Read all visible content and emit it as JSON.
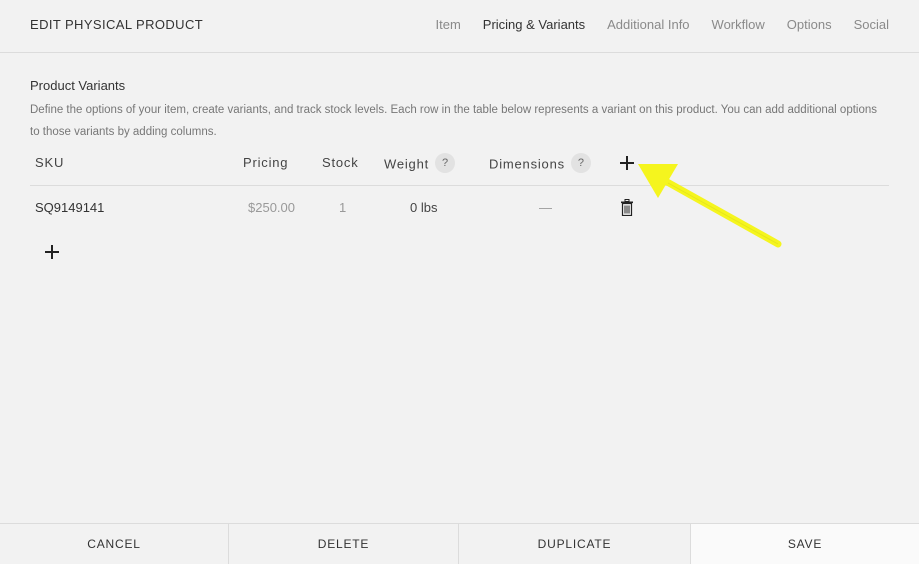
{
  "header": {
    "title": "EDIT PHYSICAL PRODUCT",
    "tabs": [
      {
        "label": "Item",
        "active": false
      },
      {
        "label": "Pricing & Variants",
        "active": true
      },
      {
        "label": "Additional Info",
        "active": false
      },
      {
        "label": "Workflow",
        "active": false
      },
      {
        "label": "Options",
        "active": false
      },
      {
        "label": "Social",
        "active": false
      }
    ]
  },
  "section": {
    "title": "Product Variants",
    "description": "Define the options of your item, create variants, and track stock levels. Each row in the table below represents a variant on this product. You can add additional options to those variants by adding columns."
  },
  "table": {
    "columns": {
      "sku": "SKU",
      "pricing": "Pricing",
      "stock": "Stock",
      "weight": "Weight",
      "dimensions": "Dimensions"
    },
    "help_glyph": "?",
    "rows": [
      {
        "sku": "SQ9149141",
        "pricing": "$250.00",
        "stock": "1",
        "weight": "0 lbs",
        "dimensions": "—"
      }
    ]
  },
  "icons": {
    "add_column": "plus-icon",
    "add_row": "plus-icon",
    "delete_row": "trash-icon",
    "help": "question-icon",
    "annotation": "arrow-icon"
  },
  "colors": {
    "background": "#f2f2f2",
    "arrow": "#f5f51e",
    "save_bg": "#fafafa"
  },
  "footer": {
    "cancel": "CANCEL",
    "delete": "DELETE",
    "duplicate": "DUPLICATE",
    "save": "SAVE"
  }
}
